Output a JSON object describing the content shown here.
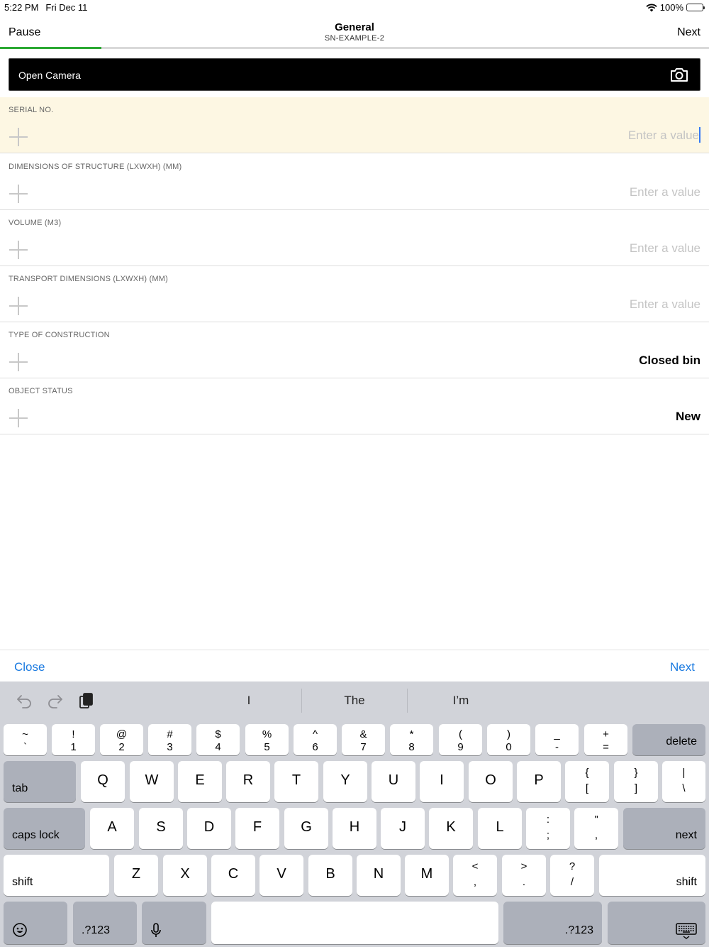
{
  "status_bar": {
    "time": "5:22 PM",
    "date": "Fri Dec 11",
    "battery": "100%"
  },
  "nav": {
    "left": "Pause",
    "title": "General",
    "subtitle": "SN-EXAMPLE-2",
    "right": "Next",
    "progress_fraction": 0.143,
    "progress_color": "#2aa832"
  },
  "camera": {
    "label": "Open Camera",
    "icon": "camera-icon"
  },
  "fields": [
    {
      "label": "SERIAL NO.",
      "value": "",
      "placeholder": "Enter a value",
      "active": true
    },
    {
      "label": "DIMENSIONS OF STRUCTURE (LXWXH) (MM)",
      "value": "",
      "placeholder": "Enter a value"
    },
    {
      "label": "VOLUME (M3)",
      "value": "",
      "placeholder": "Enter a value"
    },
    {
      "label": "TRANSPORT DIMENSIONS (LXWXH) (MM)",
      "value": "",
      "placeholder": "Enter a value"
    },
    {
      "label": "TYPE OF CONSTRUCTION",
      "value": "Closed bin",
      "placeholder": ""
    },
    {
      "label": "OBJECT STATUS",
      "value": "New",
      "placeholder": ""
    }
  ],
  "accessory": {
    "left": "Close",
    "right": "Next",
    "color": "#1a7ae0"
  },
  "keyboard": {
    "suggestions": [
      "I",
      "The",
      "I’m"
    ],
    "number_row": [
      {
        "top": "~",
        "bottom": "`"
      },
      {
        "top": "!",
        "bottom": "1"
      },
      {
        "top": "@",
        "bottom": "2"
      },
      {
        "top": "#",
        "bottom": "3"
      },
      {
        "top": "$",
        "bottom": "4"
      },
      {
        "top": "%",
        "bottom": "5"
      },
      {
        "top": "^",
        "bottom": "6"
      },
      {
        "top": "&",
        "bottom": "7"
      },
      {
        "top": "*",
        "bottom": "8"
      },
      {
        "top": "(",
        "bottom": "9"
      },
      {
        "top": ")",
        "bottom": "0"
      },
      {
        "top": "_",
        "bottom": "-"
      },
      {
        "top": "+",
        "bottom": "="
      }
    ],
    "delete": "delete",
    "tab": "tab",
    "row_q": [
      "Q",
      "W",
      "E",
      "R",
      "T",
      "Y",
      "U",
      "I",
      "O",
      "P"
    ],
    "row_q_extra": [
      {
        "top": "{",
        "bottom": "["
      },
      {
        "top": "}",
        "bottom": "]"
      },
      {
        "top": "|",
        "bottom": "\\"
      }
    ],
    "caps": "caps lock",
    "row_a": [
      "A",
      "S",
      "D",
      "F",
      "G",
      "H",
      "J",
      "K",
      "L"
    ],
    "row_a_extra": [
      {
        "top": ":",
        "bottom": ";"
      },
      {
        "top": "\"",
        "bottom": ","
      }
    ],
    "next": "next",
    "shift": "shift",
    "row_z": [
      "Z",
      "X",
      "C",
      "V",
      "B",
      "N",
      "M"
    ],
    "row_z_extra": [
      {
        "top": "<",
        "bottom": ","
      },
      {
        "top": ">",
        "bottom": "."
      },
      {
        "top": "?",
        "bottom": "/"
      }
    ],
    "numbers": ".?123"
  }
}
